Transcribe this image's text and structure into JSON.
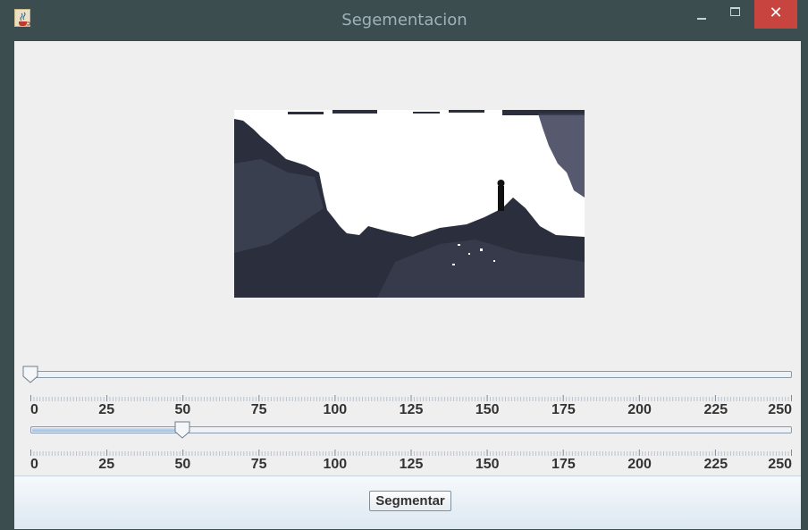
{
  "window": {
    "title": "Segementacion",
    "close_glyph": "✕",
    "icon": "java-cup-icon"
  },
  "sliders": [
    {
      "min": 0,
      "max": 250,
      "value": 0,
      "labels": [
        "0",
        "25",
        "50",
        "75",
        "100",
        "125",
        "150",
        "175",
        "200",
        "225",
        "250"
      ]
    },
    {
      "min": 0,
      "max": 250,
      "value": 50,
      "labels": [
        "0",
        "25",
        "50",
        "75",
        "100",
        "125",
        "150",
        "175",
        "200",
        "225",
        "250"
      ]
    }
  ],
  "actions": {
    "segment_label": "Segmentar"
  },
  "colors": {
    "title_bar": "#3b4d4f",
    "close_button": "#c7453e",
    "client_bg": "#efefef",
    "image_dark": "#2b2e3d"
  }
}
